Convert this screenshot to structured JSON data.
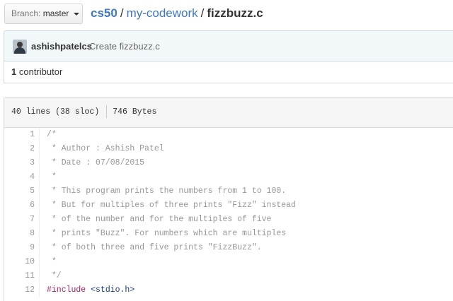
{
  "branch": {
    "label": "Branch:",
    "name": "master"
  },
  "breadcrumb": {
    "owner": "cs50",
    "repo": "my-codework",
    "file": "fizzbuzz.c",
    "separator": "/"
  },
  "commit": {
    "author": "ashishpatelcs",
    "message": "Create fizzbuzz.c"
  },
  "contributors": {
    "count": "1",
    "label": "contributor"
  },
  "file_info": {
    "lines": "40 lines (38 sloc)",
    "size": "746 Bytes"
  },
  "code_lines": [
    {
      "num": "1",
      "text": "/*"
    },
    {
      "num": "2",
      "text": " * Author : Ashish Patel"
    },
    {
      "num": "3",
      "text": " * Date : 07/08/2015"
    },
    {
      "num": "4",
      "text": " *"
    },
    {
      "num": "5",
      "text": " * This program prints the numbers from 1 to 100."
    },
    {
      "num": "6",
      "text": " * But for multiples of three prints \"Fizz\" instead"
    },
    {
      "num": "7",
      "text": " * of the number and for the multiples of five"
    },
    {
      "num": "8",
      "text": " * prints \"Buzz\". For numbers which are multiples"
    },
    {
      "num": "9",
      "text": " * of both three and five prints \"FizzBuzz\"."
    },
    {
      "num": "10",
      "text": " *"
    },
    {
      "num": "11",
      "text": " */"
    },
    {
      "num": "12",
      "directive": "#include",
      "header": "<stdio.h>"
    }
  ],
  "colors": {
    "link": "#4078c0",
    "comment": "#969896",
    "keyword": "#a71d5d",
    "string": "#183691",
    "commit_bg": "#f2f8fa"
  },
  "icons": {
    "caret": "chevron-down-icon",
    "avatar": "user-avatar"
  }
}
